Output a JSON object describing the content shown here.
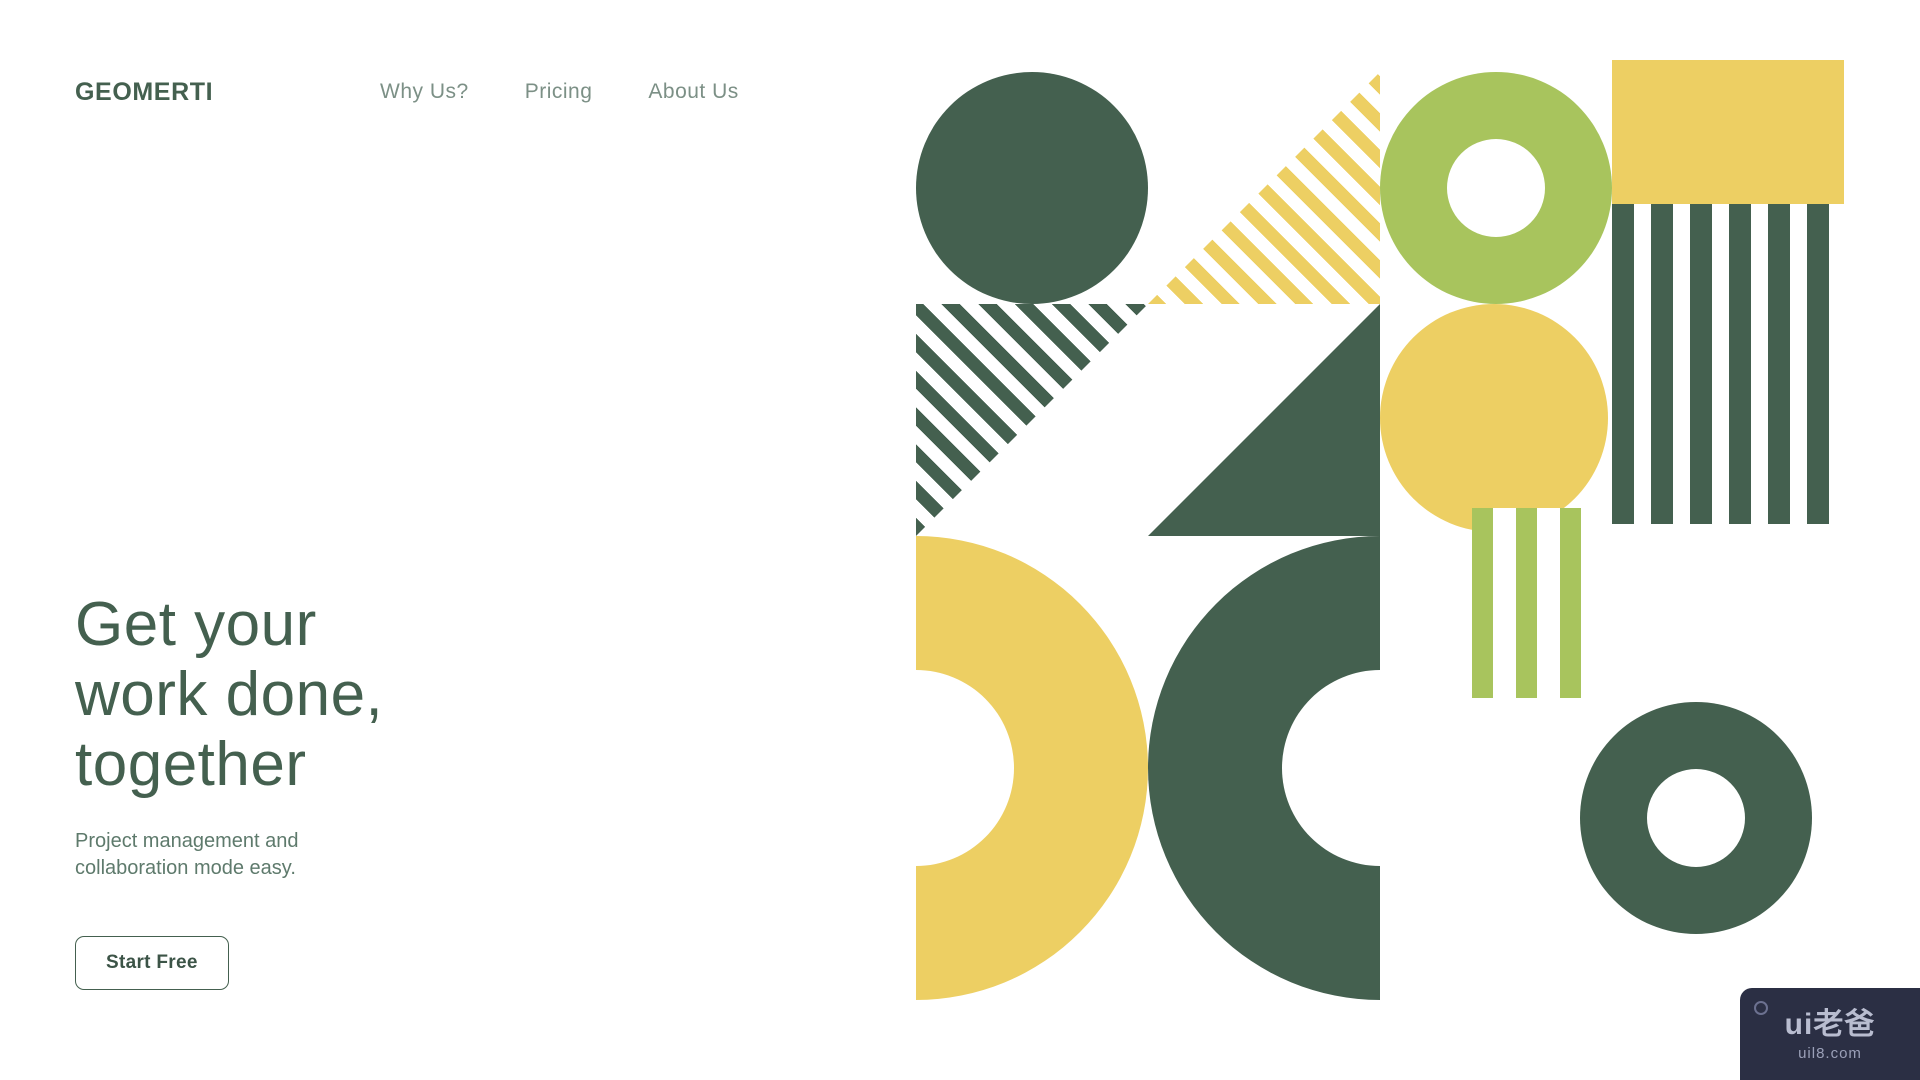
{
  "brand": {
    "name": "GEOMERTI"
  },
  "nav": {
    "items": [
      {
        "label": "Why Us?"
      },
      {
        "label": "Pricing"
      },
      {
        "label": "About Us"
      }
    ]
  },
  "hero": {
    "headline": "Get your\nwork done,\ntogether",
    "subtitle": "Project management and\ncollaboration mode easy.",
    "cta_label": "Start Free"
  },
  "colors": {
    "dark_green": "#44604f",
    "light_green": "#a8c45d",
    "yellow": "#edcf63",
    "nav_text": "#7c9086",
    "background": "#ffffff"
  },
  "artwork": {
    "description": "Abstract geometric composition grid",
    "shapes": [
      {
        "name": "circle-dark",
        "color": "#44604f"
      },
      {
        "name": "diagonal-stripes-yellow",
        "color": "#edcf63"
      },
      {
        "name": "ring-light-green",
        "color": "#a8c45d"
      },
      {
        "name": "rectangle-yellow",
        "color": "#edcf63"
      },
      {
        "name": "diagonal-stripes-dark",
        "color": "#44604f"
      },
      {
        "name": "triangle-dark",
        "color": "#44604f"
      },
      {
        "name": "circle-yellow",
        "color": "#edcf63"
      },
      {
        "name": "vertical-bars-dark",
        "color": "#44604f"
      },
      {
        "name": "half-ring-yellow",
        "color": "#edcf63"
      },
      {
        "name": "half-ring-dark",
        "color": "#44604f"
      },
      {
        "name": "vertical-bars-light-green",
        "color": "#a8c45d"
      },
      {
        "name": "ring-dark",
        "color": "#44604f"
      }
    ]
  },
  "watermark": {
    "main": "ui老爸",
    "sub": "uil8.com"
  }
}
